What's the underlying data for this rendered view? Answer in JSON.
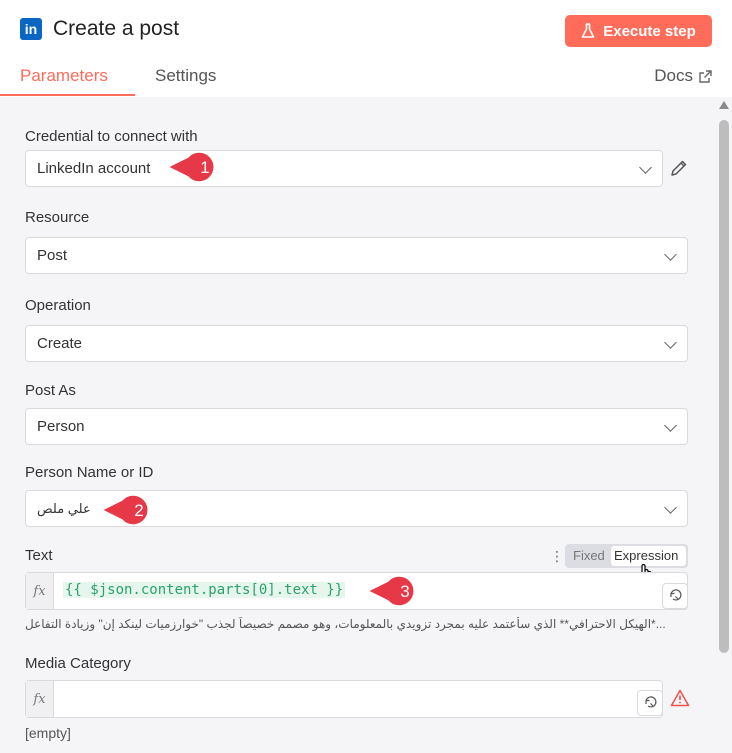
{
  "header": {
    "logo_text": "in",
    "title": "Create a post",
    "execute_label": "Execute step",
    "accent": "#ff6d5a"
  },
  "tabs": [
    {
      "label": "Parameters",
      "active": true
    },
    {
      "label": "Settings",
      "active": false
    }
  ],
  "docs_label": "Docs",
  "fields": {
    "credential": {
      "label": "Credential to connect with",
      "value": "LinkedIn account"
    },
    "resource": {
      "label": "Resource",
      "value": "Post"
    },
    "operation": {
      "label": "Operation",
      "value": "Create"
    },
    "post_as": {
      "label": "Post As",
      "value": "Person"
    },
    "person": {
      "label": "Person Name or ID",
      "value": "علي ملص"
    },
    "text": {
      "label": "Text",
      "mode_fixed": "Fixed",
      "mode_expression": "Expression",
      "fx": "fx",
      "expression": "{{ $json.content.parts[0].text }}",
      "preview": "...*الهيكل الاحترافي** الذي سأعتمد عليه بمجرد تزويدي بالمعلومات، وهو مصمم خصيصاً لجذب \"خوارزميات لينكد إن\" وزيادة التفاعل"
    },
    "media": {
      "label": "Media Category",
      "fx": "fx",
      "empty": "[empty]"
    }
  },
  "annotations": [
    "1",
    "2",
    "3"
  ]
}
